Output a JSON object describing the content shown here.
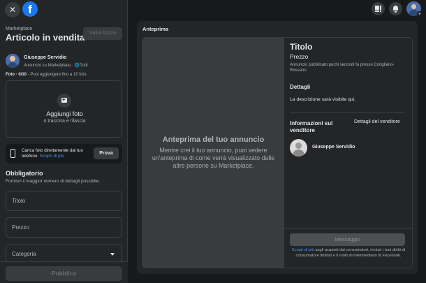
{
  "left": {
    "marketplace_label": "Marketplace",
    "title": "Articolo in vendita",
    "save_draft": "Salva bozza",
    "author": {
      "name": "Giuseppe Servidio",
      "sub": "Annuncio su Marketplace · ",
      "audience": "Tutti"
    },
    "photo_count": "Foto · 0/10",
    "photo_hint": " - Puoi aggiungere fino a 10 foto.",
    "upload": {
      "label": "Aggiungi foto",
      "sub": "o trascina e rilascia"
    },
    "phone_upload": {
      "text": "Carica foto direttamente dal tuo telefono. ",
      "link": "Scopri di più",
      "button": "Prova"
    },
    "required": {
      "title": "Obbligatorio",
      "sub": "Fornisci il maggior numero di dettagli possibile."
    },
    "fields": {
      "title": "Titolo",
      "price": "Prezzo",
      "category": "Categoria"
    },
    "publish": "Pubblica"
  },
  "preview": {
    "header": "Anteprima",
    "image_title": "Anteprima del tuo annuncio",
    "image_desc": "Mentre crei il tuo annuncio, puoi vedere un'anteprima di come verrà visualizzato dalle altre persone su Marketplace.",
    "item_title": "Titolo",
    "item_price": "Prezzo",
    "posted": "Annuncio pubblicato pochi secondi fa presso Corigliano-Rossano",
    "details_heading": "Dettagli",
    "description": "La descrizione sarà visibile qui.",
    "seller_heading": "Informazioni sul venditore",
    "seller_link": "Dettagli del venditore",
    "seller_name": "Giuseppe Servidio",
    "message_button": "Messaggio",
    "footer_link": "Scopri di più",
    "footer_text": " sugli acquisti dai consumatori, inclusi i tuoi diritti di consumatore limitati e il ruolo di intermediario di Facebook."
  },
  "icons": {
    "close": "close-icon",
    "logo": "facebook-logo-icon",
    "menu": "grid-menu-icon",
    "notifications": "bell-icon",
    "profile": "profile-avatar-icon"
  },
  "colors": {
    "background": "#18191a",
    "panel": "#242526",
    "accent": "#1877f2",
    "link": "#4599ff"
  }
}
